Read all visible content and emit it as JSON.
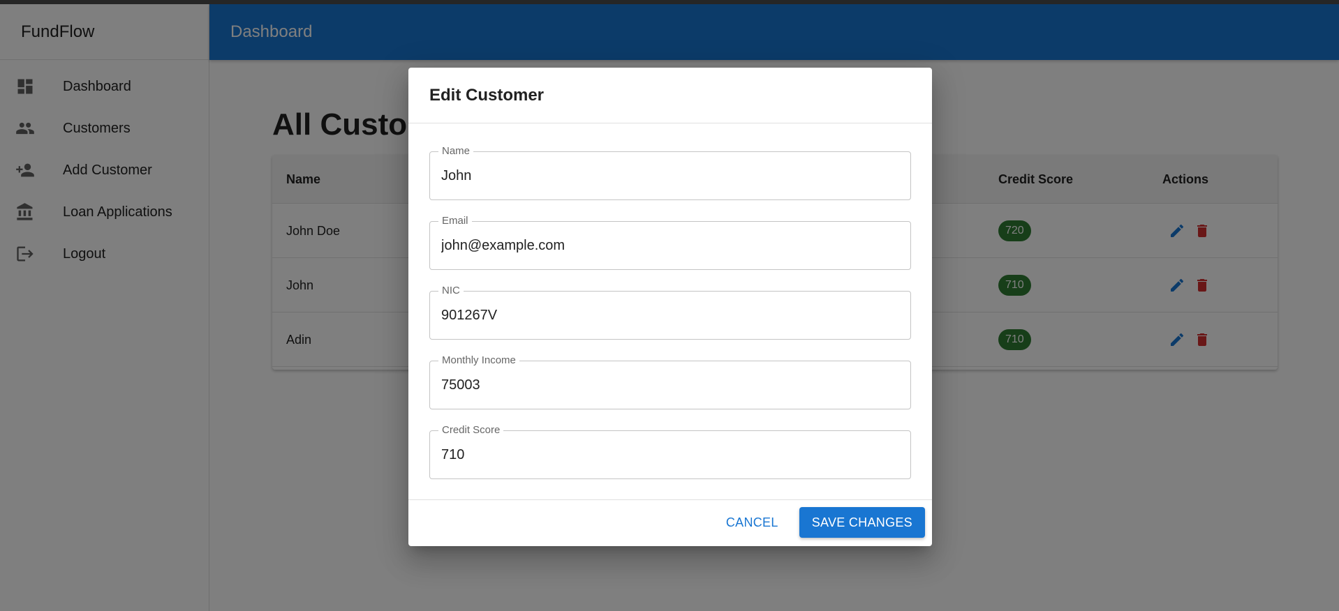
{
  "app": {
    "brand": "FundFlow"
  },
  "appbar": {
    "title": "Dashboard"
  },
  "sidebar": {
    "items": [
      {
        "label": "Dashboard",
        "icon": "dashboard-icon"
      },
      {
        "label": "Customers",
        "icon": "people-icon"
      },
      {
        "label": "Add Customer",
        "icon": "person-add-icon"
      },
      {
        "label": "Loan Applications",
        "icon": "bank-icon"
      },
      {
        "label": "Logout",
        "icon": "logout-icon"
      }
    ]
  },
  "main": {
    "title": "All Customers",
    "table": {
      "columns": [
        "Name",
        "Credit Score",
        "Actions"
      ],
      "rows": [
        {
          "name": "John Doe",
          "credit_score": "720"
        },
        {
          "name": "John",
          "credit_score": "710"
        },
        {
          "name": "Adin",
          "credit_score": "710"
        }
      ]
    }
  },
  "dialog": {
    "title": "Edit Customer",
    "fields": [
      {
        "label": "Name",
        "value": "John"
      },
      {
        "label": "Email",
        "value": "john@example.com"
      },
      {
        "label": "NIC",
        "value": "901267V"
      },
      {
        "label": "Monthly Income",
        "value": "75003"
      },
      {
        "label": "Credit Score",
        "value": "710"
      }
    ],
    "cancel_label": "CANCEL",
    "save_label": "SAVE CHANGES"
  },
  "colors": {
    "primary": "#1976d2",
    "score_chip": "#2e7d32",
    "delete": "#d32f2f"
  }
}
